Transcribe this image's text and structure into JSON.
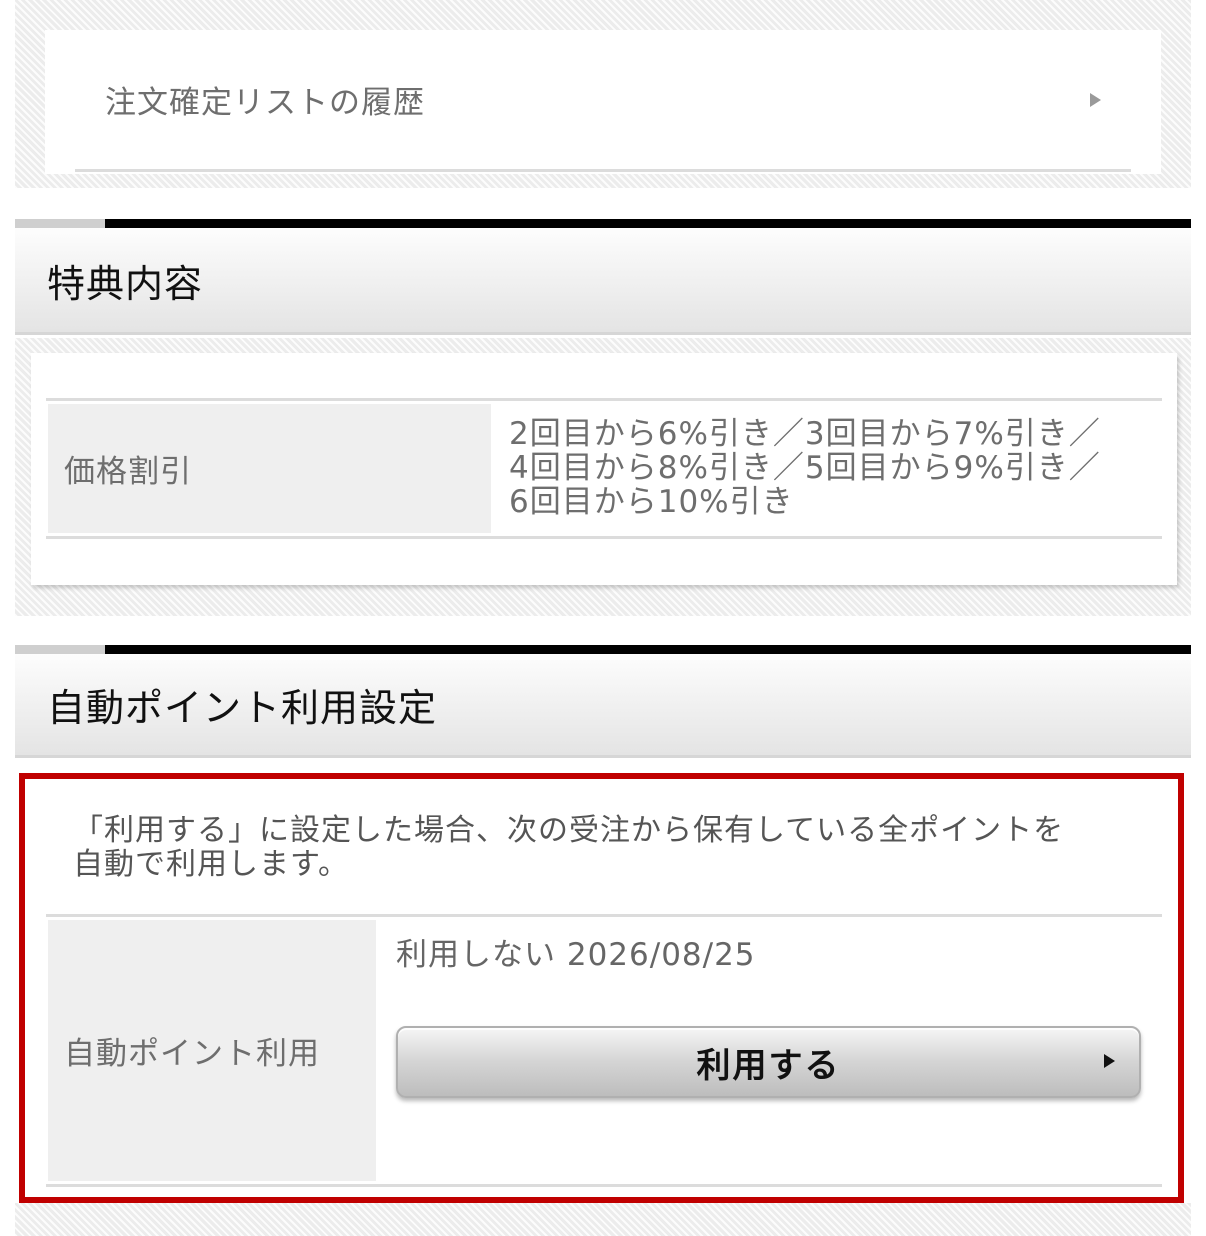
{
  "history": {
    "label": "注文確定リストの履歴"
  },
  "benefit": {
    "title": "特典内容",
    "row_label": "価格割引",
    "row_value_lines": [
      "2回目から6%引き／3回目から7%引き／",
      "4回目から8%引き／5回目から9%引き／",
      "6回目から10%引き"
    ]
  },
  "auto_point": {
    "title": "自動ポイント利用設定",
    "description_lines": [
      "「利用する」に設定した場合、次の受注から保有している全ポイントを",
      "自動で利用します。"
    ],
    "row_label": "自動ポイント利用",
    "status": "利用しない 2026/08/25",
    "button_label": "利用する"
  },
  "colors": {
    "highlight_border": "#c00000",
    "section_bar": "#000000",
    "label_cell_bg": "#efefef"
  }
}
